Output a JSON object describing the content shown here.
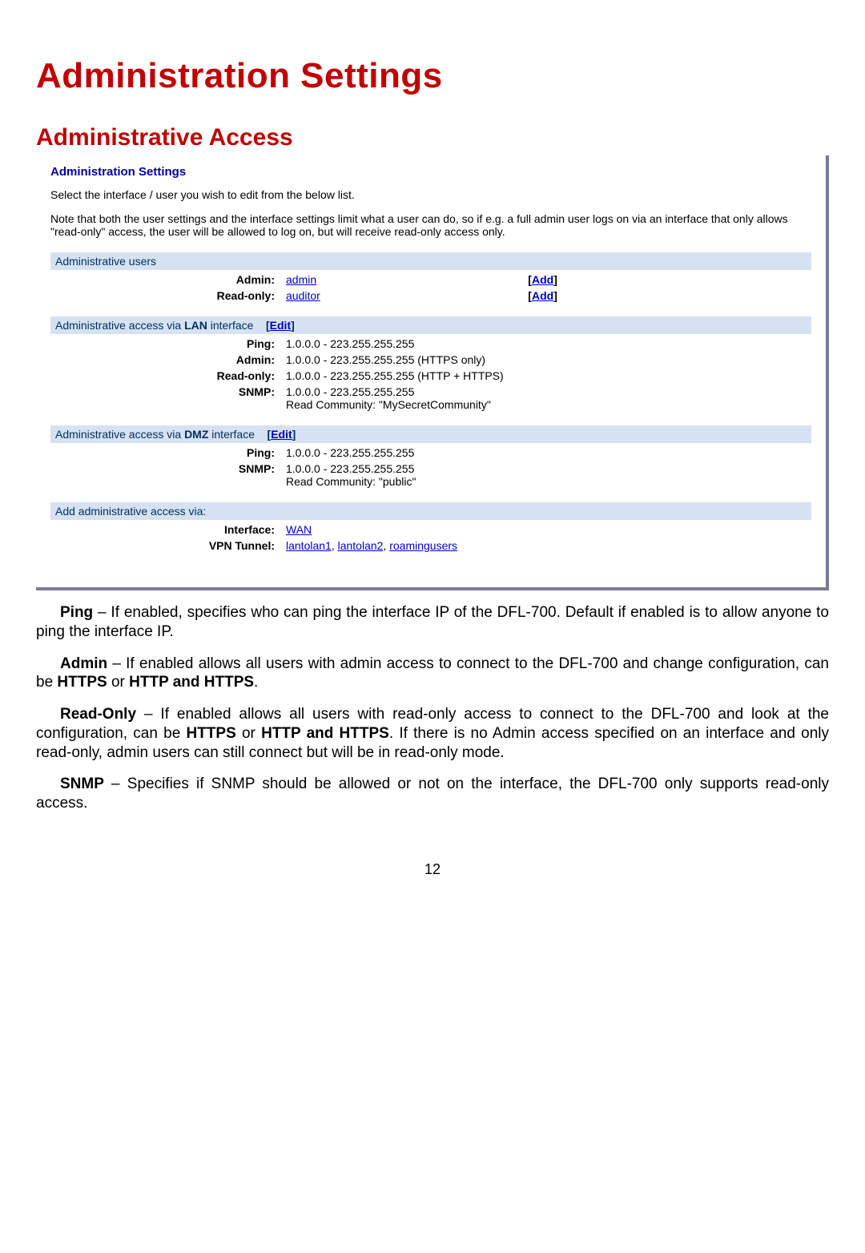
{
  "title": "Administration Settings",
  "subtitle": "Administrative Access",
  "panel": {
    "heading": "Administration Settings",
    "instr": "Select the interface / user you wish to edit from the below list.",
    "note": "Note that both the user settings and the interface settings limit what a user can do, so if e.g. a full admin user logs on via an interface that only allows \"read-only\" access, the user will be allowed to log on, but will receive read-only access only.",
    "users": {
      "header": "Administrative users",
      "admin_label": "Admin:",
      "admin_link": "admin",
      "add_label": "Add",
      "readonly_label": "Read-only:",
      "readonly_link": "auditor"
    },
    "lan": {
      "header_pre": "Administrative access via ",
      "header_bold": "LAN",
      "header_post": " interface",
      "edit_label": "Edit",
      "ping_label": "Ping:",
      "ping_val": "1.0.0.0 - 223.255.255.255",
      "admin_label": "Admin:",
      "admin_val": "1.0.0.0 - 223.255.255.255 (HTTPS only)",
      "readonly_label": "Read-only:",
      "readonly_val": "1.0.0.0 - 223.255.255.255 (HTTP + HTTPS)",
      "snmp_label": "SNMP:",
      "snmp_val1": "1.0.0.0 - 223.255.255.255",
      "snmp_val2": "Read Community: \"MySecretCommunity\""
    },
    "dmz": {
      "header_pre": "Administrative access via ",
      "header_bold": "DMZ",
      "header_post": " interface",
      "edit_label": "Edit",
      "ping_label": "Ping:",
      "ping_val": "1.0.0.0 - 223.255.255.255",
      "snmp_label": "SNMP:",
      "snmp_val1": "1.0.0.0 - 223.255.255.255",
      "snmp_val2": "Read Community: \"public\""
    },
    "add": {
      "header": "Add administrative access via:",
      "iface_label": "Interface:",
      "iface_link": "WAN",
      "vpn_label": "VPN Tunnel:",
      "vpn_link1": "lantolan1",
      "vpn_link2": "lantolan2",
      "vpn_link3": "roamingusers"
    }
  },
  "paras": {
    "ping_b": "Ping",
    "ping_t": " – If enabled, specifies who can ping the interface IP of the DFL-700. Default if enabled is to allow anyone to ping the interface IP.",
    "admin_b": "Admin",
    "admin_t1": " – If enabled allows all users with admin access to connect to the DFL-700 and change configuration, can be ",
    "admin_h1": "HTTPS",
    "admin_t2": " or ",
    "admin_h2": "HTTP and HTTPS",
    "admin_t3": ".",
    "ro_b": "Read-Only",
    "ro_t1": " – If enabled allows all users with read-only access to connect to the DFL-700 and look at the configuration, can be ",
    "ro_h1": "HTTPS",
    "ro_t2": " or ",
    "ro_h2": "HTTP and HTTPS",
    "ro_t3": ". If there is no Admin access specified on an interface and only read-only, admin users can still connect but will be in read-only mode.",
    "snmp_b": "SNMP",
    "snmp_t": " – Specifies if SNMP should be allowed or not on the interface, the DFL-700 only supports read-only access."
  },
  "page_number": "12"
}
